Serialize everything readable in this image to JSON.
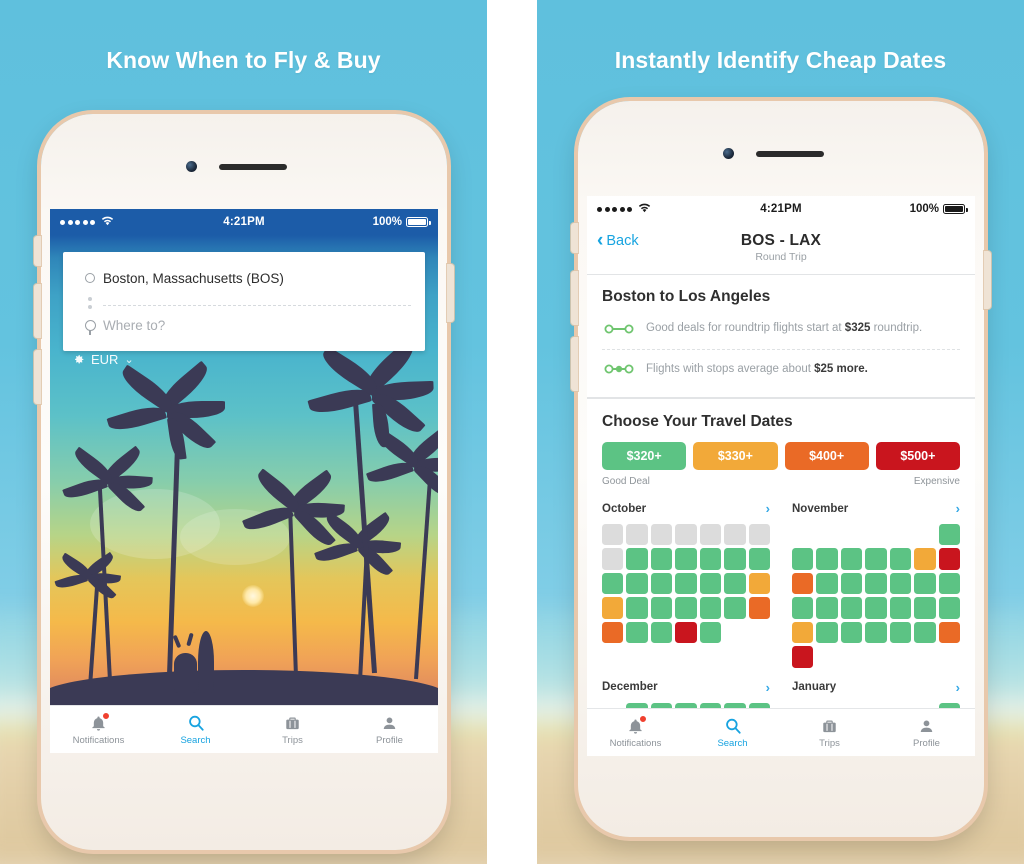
{
  "panels": [
    {
      "title": "Know When to Fly & Buy"
    },
    {
      "title": "Instantly Identify Cheap Dates"
    }
  ],
  "colors": {
    "background": "#63c3df",
    "accent": "#17a3e0",
    "good_deal": "#5cc384",
    "fair": "#f2a939",
    "pricey": "#ea6a26",
    "expensive": "#c9151e",
    "empty_cell": "#dcdcdc",
    "navy": "#1c5ca8"
  },
  "left_phone": {
    "status_bar": {
      "signal_icon": "signal-dots-icon",
      "wifi_icon": "wifi-icon",
      "time": "4:21PM",
      "battery_percent": "100%",
      "battery_icon": "battery-full-icon"
    },
    "search_card": {
      "origin_icon": "circle-ring-icon",
      "origin_value": "Boston, Massachusetts (BOS)",
      "destination_icon": "map-pin-icon",
      "destination_placeholder": "Where to?",
      "destination_value": ""
    },
    "currency": {
      "gear_icon": "gear-icon",
      "label": "EUR",
      "chevron_icon": "chevron-down-icon"
    },
    "tabs": [
      {
        "label": "Notifications",
        "icon": "bell-icon",
        "active": false,
        "badge": true
      },
      {
        "label": "Search",
        "icon": "search-icon",
        "active": true,
        "badge": false
      },
      {
        "label": "Trips",
        "icon": "briefcase-icon",
        "active": false,
        "badge": false
      },
      {
        "label": "Profile",
        "icon": "person-icon",
        "active": false,
        "badge": false
      }
    ]
  },
  "right_phone": {
    "status_bar": {
      "signal_icon": "signal-dots-icon",
      "wifi_icon": "wifi-icon",
      "time": "4:21PM",
      "battery_percent": "100%",
      "battery_icon": "battery-full-icon"
    },
    "nav": {
      "back_icon": "chevron-left-icon",
      "back_label": "Back",
      "title": "BOS - LAX",
      "subtitle": "Round Trip"
    },
    "route": {
      "title": "Boston to Los Angeles",
      "facts": [
        {
          "icon": "nonstop-route-icon",
          "text_before": "Good deals for roundtrip flights start at ",
          "bold": "$325",
          "text_after": " roundtrip."
        },
        {
          "icon": "one-stop-route-icon",
          "text_before": "Flights with stops average about ",
          "bold": "$25 more.",
          "text_after": ""
        }
      ]
    },
    "dates": {
      "title": "Choose Your Travel Dates",
      "legend_chips": [
        {
          "label": "$320+",
          "color": "#5cc384"
        },
        {
          "label": "$330+",
          "color": "#f2a939"
        },
        {
          "label": "$400+",
          "color": "#ea6a26"
        },
        {
          "label": "$500+",
          "color": "#c9151e"
        }
      ],
      "legend_low_label": "Good Deal",
      "legend_high_label": "Expensive",
      "months": [
        {
          "name": "October",
          "arrow_icon": "chevron-right-icon",
          "cells": [
            [
              "e",
              "e",
              "e",
              "e",
              "e",
              "e",
              "e"
            ],
            [
              "e",
              "g",
              "g",
              "g",
              "g",
              "g",
              "g"
            ],
            [
              "g",
              "g",
              "g",
              "g",
              "g",
              "g",
              "a"
            ],
            [
              "a",
              "g",
              "g",
              "g",
              "g",
              "g",
              "o"
            ],
            [
              "o",
              "g",
              "g",
              "r",
              "g",
              "",
              ""
            ]
          ]
        },
        {
          "name": "November",
          "arrow_icon": "chevron-right-icon",
          "cells": [
            [
              "",
              "",
              "",
              "",
              "",
              "",
              "g"
            ],
            [
              "g",
              "g",
              "g",
              "g",
              "g",
              "a",
              "r"
            ],
            [
              "o",
              "g",
              "g",
              "g",
              "g",
              "g",
              "g"
            ],
            [
              "g",
              "g",
              "g",
              "g",
              "g",
              "g",
              "g"
            ],
            [
              "a",
              "g",
              "g",
              "g",
              "g",
              "g",
              "o"
            ],
            [
              "r",
              "",
              "",
              "",
              "",
              "",
              ""
            ]
          ]
        },
        {
          "name": "December",
          "arrow_icon": "chevron-right-icon",
          "cells": [
            [
              "",
              "g",
              "g",
              "g",
              "g",
              "g",
              "g"
            ],
            [
              "g",
              "g",
              "g",
              "g",
              "g",
              "g",
              "g"
            ]
          ]
        },
        {
          "name": "January",
          "arrow_icon": "chevron-right-icon",
          "cells": [
            [
              "",
              "",
              "",
              "",
              "",
              "",
              "g"
            ],
            [
              "g",
              "g",
              "g",
              "g",
              "g",
              "a",
              "r"
            ]
          ]
        }
      ]
    },
    "tabs": [
      {
        "label": "Notifications",
        "icon": "bell-icon",
        "active": false,
        "badge": true
      },
      {
        "label": "Search",
        "icon": "search-icon",
        "active": true,
        "badge": false
      },
      {
        "label": "Trips",
        "icon": "briefcase-icon",
        "active": false,
        "badge": false
      },
      {
        "label": "Profile",
        "icon": "person-icon",
        "active": false,
        "badge": false
      }
    ]
  }
}
